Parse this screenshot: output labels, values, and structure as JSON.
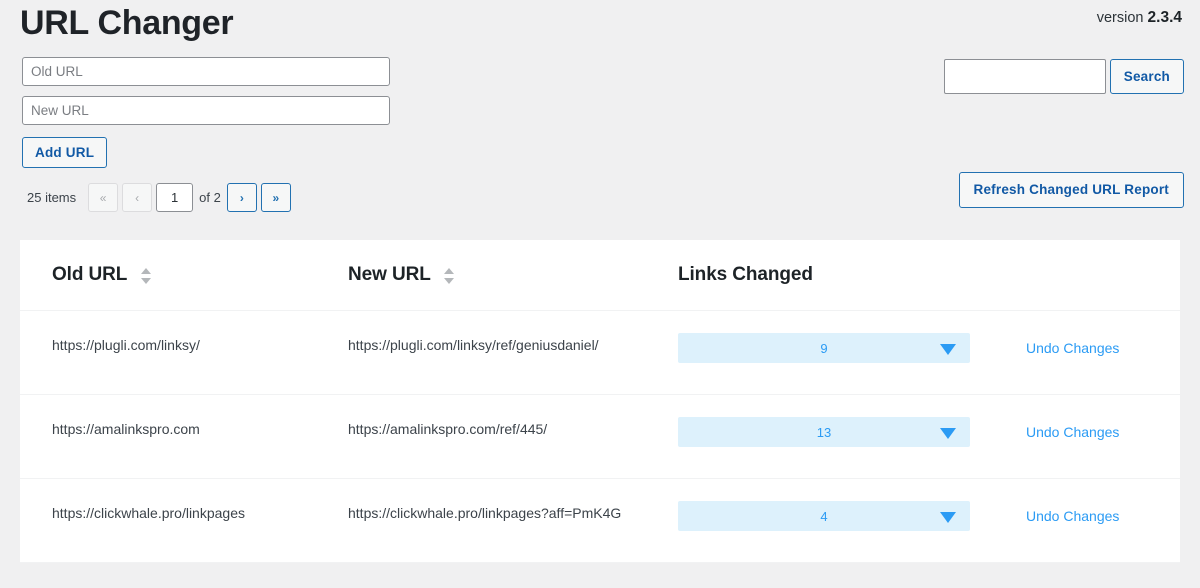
{
  "header": {
    "title": "URL Changer",
    "version_label": "version",
    "version_number": "2.3.4"
  },
  "form": {
    "old_url_placeholder": "Old URL",
    "old_url_value": "",
    "new_url_placeholder": "New URL",
    "new_url_value": "",
    "add_button_label": "Add URL"
  },
  "search": {
    "value": "",
    "placeholder": "",
    "button_label": "Search"
  },
  "pagination": {
    "item_count": "25 items",
    "first_label": "«",
    "prev_label": "‹",
    "current_page": "1",
    "of_label": "of 2",
    "next_label": "›",
    "last_label": "»"
  },
  "report": {
    "refresh_button_label": "Refresh Changed URL Report"
  },
  "table": {
    "columns": {
      "old_url": "Old URL",
      "new_url": "New URL",
      "links_changed": "Links Changed"
    },
    "rows": [
      {
        "old_url": "https://plugli.com/linksy/",
        "new_url": "https://plugli.com/linksy/ref/geniusdaniel/",
        "links_changed": "9",
        "action_label": "Undo Changes"
      },
      {
        "old_url": "https://amalinkspro.com",
        "new_url": "https://amalinkspro.com/ref/445/",
        "links_changed": "13",
        "action_label": "Undo Changes"
      },
      {
        "old_url": "https://clickwhale.pro/linkpages",
        "new_url": "https://clickwhale.pro/linkpages?aff=PmK4G",
        "links_changed": "4",
        "action_label": "Undo Changes"
      }
    ]
  },
  "colors": {
    "page_background": "#f0f0f1",
    "card_background": "#ffffff",
    "accent_blue": "#2271b1",
    "link_blue": "#2b9bf4",
    "select_background": "#ddf1fc",
    "text_dark": "#1d2327"
  }
}
